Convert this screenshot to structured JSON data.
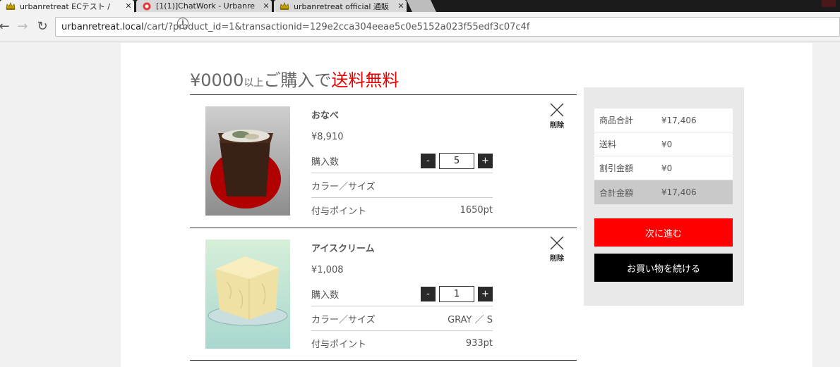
{
  "browser": {
    "tabs": [
      {
        "title": "urbanretreat ECテスト /",
        "icon": "crown-favicon-icon",
        "active": true
      },
      {
        "title": "[1(1)]ChatWork - Urbanre",
        "icon": "chatwork-favicon-icon",
        "active": false
      },
      {
        "title": "urbanretreat official 通販",
        "icon": "crown-favicon-icon",
        "active": false
      }
    ],
    "tab_close": "✕",
    "url_host": "urbanretreat.local",
    "url_path": "/cart/?product_id=1&transactionid=129e2cca304eeae5c0e5152a023f55edf3c07c4f"
  },
  "headline": {
    "amount": "¥0000",
    "suffix_small": "以上",
    "mid": "ご購入で",
    "highlight": "送料無料"
  },
  "colors": {
    "accent_red": "#ff0000",
    "headline_red": "#e60000"
  },
  "cart": {
    "qty_label": "購入数",
    "option_label": "カラー／サイズ",
    "points_label": "付与ポイント",
    "remove_label": "削除",
    "minus": "-",
    "plus": "+",
    "items": [
      {
        "name": "おなべ",
        "price": "¥8,910",
        "quantity": "5",
        "option": "",
        "points": "1650pt"
      },
      {
        "name": "アイスクリーム",
        "price": "¥1,008",
        "quantity": "1",
        "option": "GRAY ／ S",
        "points": "933pt"
      }
    ]
  },
  "summary": {
    "rows": [
      {
        "label": "商品合計",
        "value": "¥17,406"
      },
      {
        "label": "送料",
        "value": "¥0"
      },
      {
        "label": "割引金額",
        "value": "¥0"
      },
      {
        "label": "合計金額",
        "value": "¥17,406"
      }
    ],
    "next_button": "次に進む",
    "continue_button": "お買い物を続ける"
  }
}
